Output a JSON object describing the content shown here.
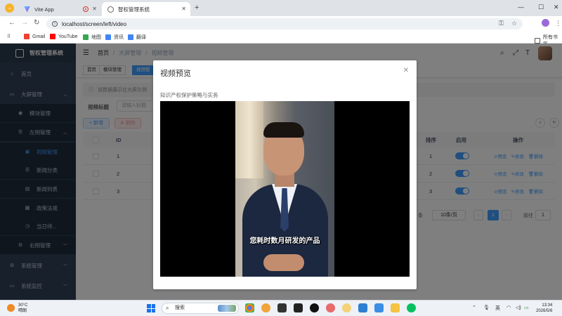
{
  "browser": {
    "tabs": [
      {
        "title": "Vite App"
      },
      {
        "title": "智权管理系统"
      }
    ],
    "url": "localhost/screen/left/video",
    "bookmarks": [
      "Gmail",
      "YouTube",
      "地图",
      "资讯",
      "翻译"
    ],
    "all_bookmarks": "所有书签"
  },
  "app": {
    "title": "智权管理系统",
    "sidebar": {
      "items": [
        {
          "label": "首页",
          "icon": "home-icon"
        },
        {
          "label": "大屏管理",
          "icon": "monitor-icon"
        },
        {
          "label": "模块管理",
          "icon": "eye-icon"
        },
        {
          "label": "左侧管理",
          "icon": "list-icon"
        },
        {
          "label": "视频管理",
          "icon": "video-icon"
        },
        {
          "label": "新闻分类",
          "icon": "list-icon"
        },
        {
          "label": "新闻列表",
          "icon": "message-icon"
        },
        {
          "label": "政策法规",
          "icon": "doc-icon"
        },
        {
          "label": "当日待...",
          "icon": "clock-icon"
        },
        {
          "label": "右侧管理",
          "icon": "gear-icon"
        },
        {
          "label": "系统管理",
          "icon": "gear-icon"
        },
        {
          "label": "系统监控",
          "icon": "monitor-icon"
        }
      ]
    },
    "breadcrumb": [
      "首页",
      "大屏管理",
      "视频管理"
    ],
    "tags": [
      "首页",
      "模块管理",
      "视频管"
    ],
    "notice": "该数据展示在大屏左侧",
    "search": {
      "label": "视频标题",
      "placeholder": "请输入标题"
    },
    "buttons": {
      "add": "新增",
      "delete": "删除"
    },
    "table": {
      "headers": {
        "id": "ID",
        "sort": "排序",
        "enabled": "启用",
        "ops": "操作"
      },
      "rows": [
        {
          "id": "1",
          "sort": "1"
        },
        {
          "id": "2",
          "sort": "2"
        },
        {
          "id": "3",
          "sort": "3"
        }
      ],
      "ops": [
        "预览",
        "修改",
        "删除"
      ]
    },
    "pagination": {
      "total_suffix": "条",
      "page_size": "10条/页",
      "current": "1",
      "goto_label": "前往",
      "goto_value": "1"
    }
  },
  "dialog": {
    "title": "视频预览",
    "video_title": "知识产权保护策略与实务",
    "subtitle": "您耗时数月研发的产品"
  },
  "taskbar": {
    "weather_temp": "30°C",
    "weather_desc": "晴朗",
    "search": "搜索",
    "ime": "英",
    "time": "13:34",
    "date": "2026/5/6"
  },
  "colors": {
    "primary": "#409eff",
    "sidebar": "#304156",
    "danger": "#f56c6c"
  }
}
